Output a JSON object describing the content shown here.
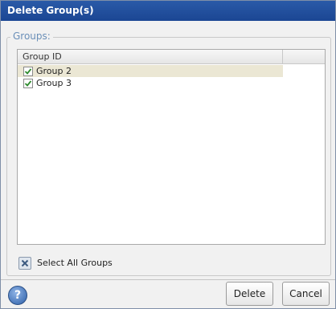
{
  "dialog": {
    "title": "Delete Group(s)",
    "groups_label": "Groups:",
    "column_header": "Group ID",
    "rows": [
      {
        "label": "Group 2",
        "checked": true,
        "selected": true
      },
      {
        "label": "Group 3",
        "checked": true,
        "selected": false
      }
    ],
    "select_all_label": "Select All Groups",
    "buttons": {
      "delete": "Delete",
      "cancel": "Cancel"
    },
    "help_glyph": "?",
    "colors": {
      "titlebar": "#1b4693",
      "check": "#2e8b2e",
      "selected_row": "#ebe7d4"
    }
  }
}
